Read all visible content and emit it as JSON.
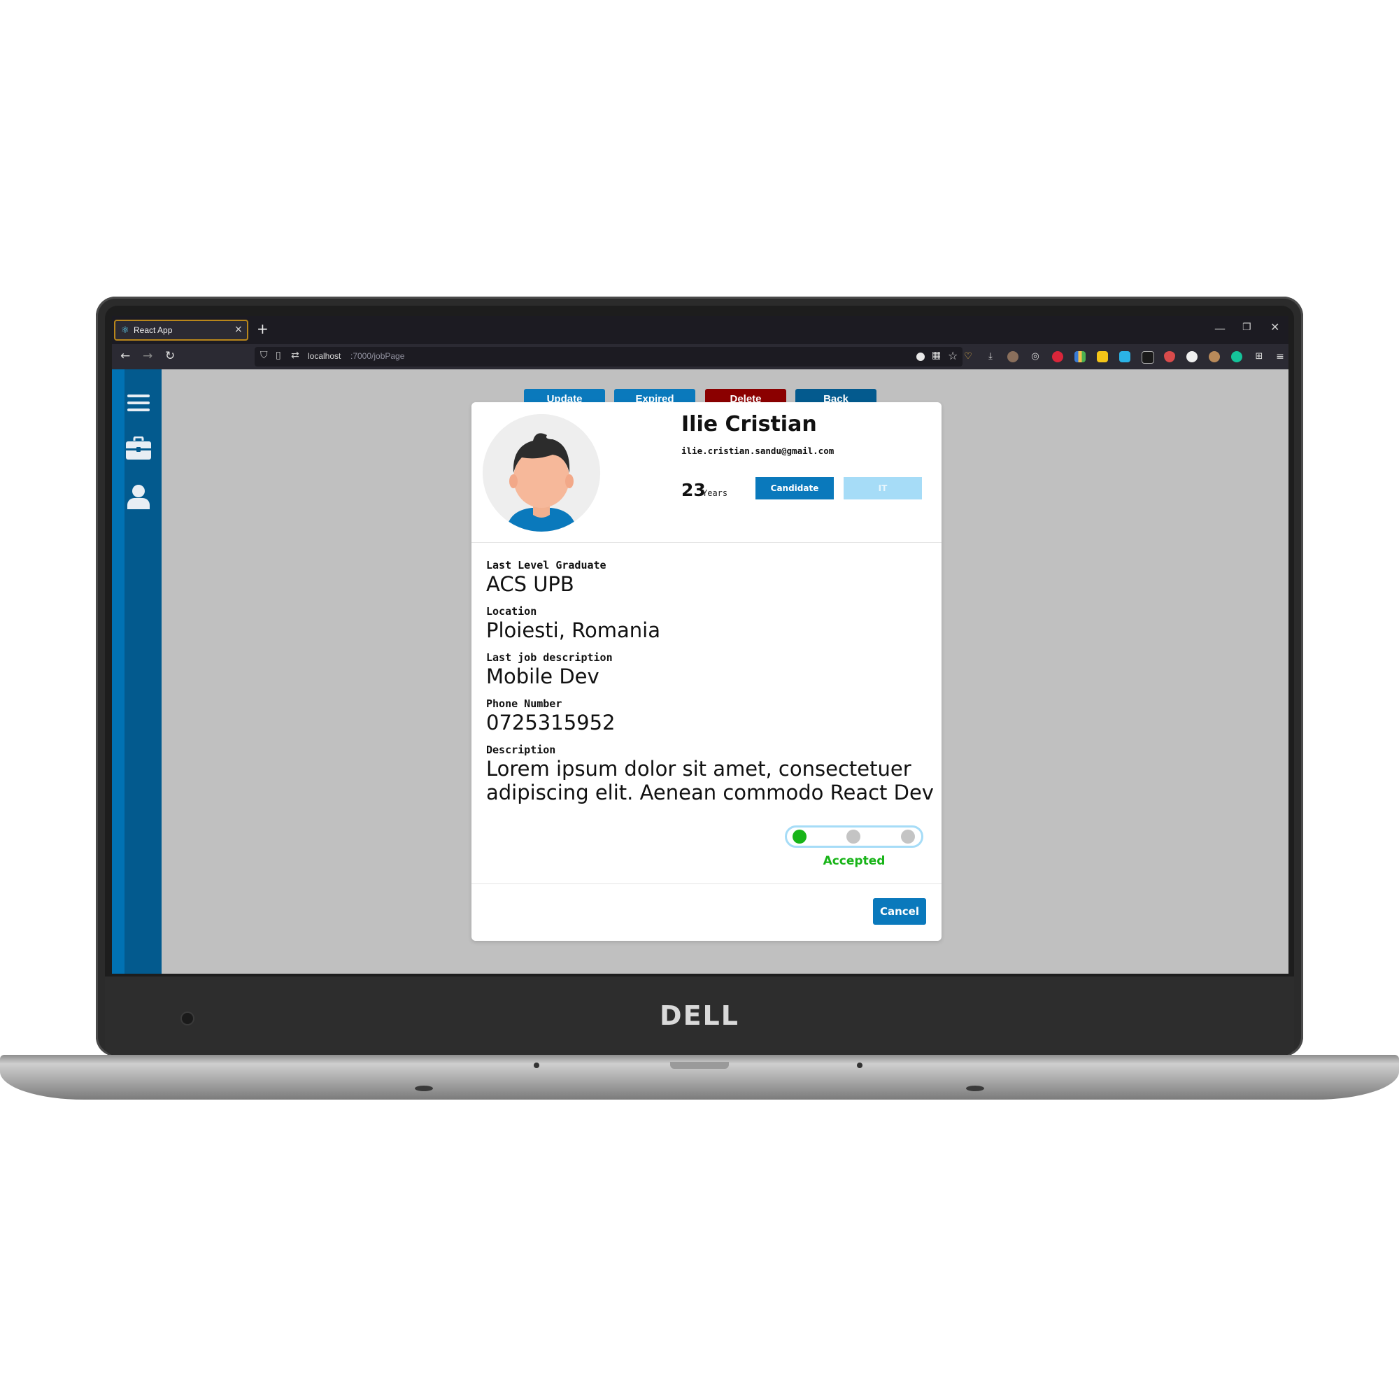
{
  "browser": {
    "tab_title": "React App",
    "url_host": "localhost",
    "url_path": ":7000/jobPage"
  },
  "laptop": {
    "brand": "DELL"
  },
  "actions": {
    "update": "Update",
    "expired": "Expired",
    "delete": "Delete",
    "back": "Back"
  },
  "profile": {
    "name": "Ilie Cristian",
    "email": "ilie.cristian.sandu@gmail.com",
    "age": "23",
    "age_unit": "Years",
    "role": "Candidate",
    "department": "IT"
  },
  "fields": [
    {
      "label": "Last Level Graduate",
      "value": "ACS UPB"
    },
    {
      "label": "Location",
      "value": "Ploiesti, Romania"
    },
    {
      "label": "Last job description",
      "value": "Mobile Dev"
    },
    {
      "label": "Phone Number",
      "value": "0725315952"
    },
    {
      "label": "Description",
      "value": "Lorem ipsum dolor sit amet, consectetuer adipiscing elit. Aenean commodo React Dev"
    }
  ],
  "status": {
    "label": "Accepted",
    "active_step": 1,
    "total_steps": 3
  },
  "footer": {
    "cancel": "Cancel"
  },
  "colors": {
    "primary": "#0a79bc",
    "sidebar": "#035a8e",
    "danger": "#8b0000",
    "success": "#18b418",
    "badge_light": "#a6dcf7"
  }
}
